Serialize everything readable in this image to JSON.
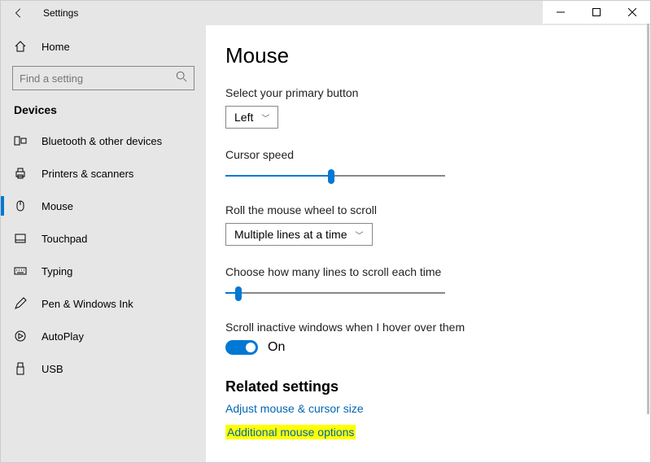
{
  "window": {
    "title": "Settings"
  },
  "sidebar": {
    "home_label": "Home",
    "search_placeholder": "Find a setting",
    "category": "Devices",
    "items": [
      {
        "label": "Bluetooth & other devices",
        "icon": "bluetooth-devices"
      },
      {
        "label": "Printers & scanners",
        "icon": "printer"
      },
      {
        "label": "Mouse",
        "icon": "mouse",
        "selected": true
      },
      {
        "label": "Touchpad",
        "icon": "touchpad"
      },
      {
        "label": "Typing",
        "icon": "keyboard"
      },
      {
        "label": "Pen & Windows Ink",
        "icon": "pen"
      },
      {
        "label": "AutoPlay",
        "icon": "autoplay"
      },
      {
        "label": "USB",
        "icon": "usb"
      }
    ]
  },
  "page": {
    "title": "Mouse",
    "primary_button": {
      "label": "Select your primary button",
      "value": "Left"
    },
    "cursor_speed": {
      "label": "Cursor speed",
      "percent": 48
    },
    "scroll_mode": {
      "label": "Roll the mouse wheel to scroll",
      "value": "Multiple lines at a time"
    },
    "scroll_lines": {
      "label": "Choose how many lines to scroll each time",
      "percent": 6
    },
    "inactive_scroll": {
      "label": "Scroll inactive windows when I hover over them",
      "state_text": "On"
    },
    "related_header": "Related settings",
    "link_adjust": "Adjust mouse & cursor size",
    "link_additional": "Additional mouse options"
  }
}
